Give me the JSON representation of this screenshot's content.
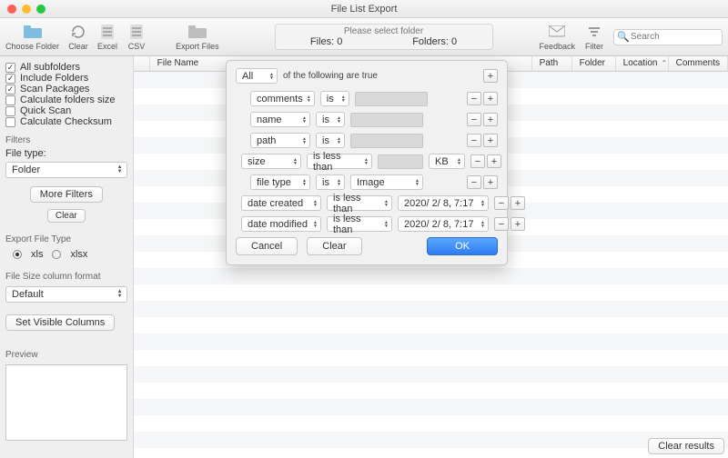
{
  "window": {
    "title": "File List Export"
  },
  "toolbar": {
    "choose_folder": "Choose Folder",
    "clear": "Clear",
    "excel": "Excel",
    "csv": "CSV",
    "export_files": "Export Files",
    "feedback": "Feedback",
    "filter": "Filter",
    "info_line": "Please select folder",
    "files_label": "Files: 0",
    "folders_label": "Folders: 0",
    "search_placeholder": "Search"
  },
  "sidebar": {
    "options": [
      {
        "label": "All subfolders",
        "checked": true
      },
      {
        "label": "Include Folders",
        "checked": true
      },
      {
        "label": "Scan Packages",
        "checked": true
      },
      {
        "label": "Calculate folders size",
        "checked": false
      },
      {
        "label": "Quick Scan",
        "checked": false
      },
      {
        "label": "Calculate Checksum",
        "checked": false
      }
    ],
    "filters_header": "Filters",
    "file_type_label": "File type:",
    "file_type_value": "Folder",
    "more_filters": "More Filters",
    "clear": "Clear",
    "export_type_header": "Export File Type",
    "export_type": {
      "xls": "xls",
      "xlsx": "xlsx",
      "selected": "xls"
    },
    "size_format_header": "File Size column format",
    "size_format_value": "Default",
    "set_visible_columns": "Set Visible Columns",
    "preview_header": "Preview"
  },
  "table": {
    "columns": [
      "File Name",
      "Path",
      "Folder",
      "Location",
      "Comments"
    ]
  },
  "modal": {
    "match": "All",
    "match_suffix": "of the following are true",
    "rows": [
      {
        "field": "comments",
        "op": "is",
        "value_kind": "text"
      },
      {
        "field": "name",
        "op": "is",
        "value_kind": "text"
      },
      {
        "field": "path",
        "op": "is",
        "value_kind": "text"
      },
      {
        "field": "size",
        "op": "is less than",
        "value_kind": "size",
        "unit": "KB"
      },
      {
        "field": "file type",
        "op": "is",
        "value_kind": "filetype",
        "filetype": "Image"
      },
      {
        "field": "date created",
        "op": "is less than",
        "value_kind": "date",
        "date": "2020/ 2/ 8,  7:17"
      },
      {
        "field": "date modified",
        "op": "is less than",
        "value_kind": "date",
        "date": "2020/ 2/ 8,  7:17"
      }
    ],
    "cancel": "Cancel",
    "clear": "Clear",
    "ok": "OK"
  },
  "footer": {
    "clear_results": "Clear results"
  }
}
